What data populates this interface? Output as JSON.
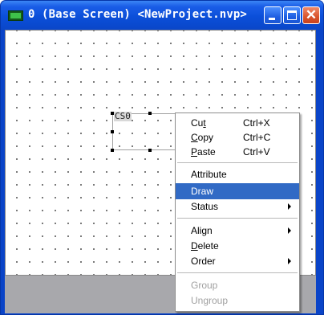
{
  "window": {
    "title": "0 (Base Screen) <NewProject.nvp>",
    "icons": {
      "app": "screen-icon",
      "minimize": "minimize-icon",
      "maximize": "maximize-icon",
      "close": "close-icon"
    },
    "close_glyph": "✕"
  },
  "object": {
    "label": "CS0"
  },
  "menu": {
    "items": [
      {
        "label_pre": "Cu",
        "label_acc": "t",
        "label_post": "",
        "shortcut": "Ctrl+X"
      },
      {
        "label_pre": "",
        "label_acc": "C",
        "label_post": "opy",
        "shortcut": "Ctrl+C"
      },
      {
        "label_pre": "",
        "label_acc": "P",
        "label_post": "aste",
        "shortcut": "Ctrl+V"
      },
      {
        "label": "Attribute"
      },
      {
        "label": "Draw",
        "state": "highlighted"
      },
      {
        "label": "Status",
        "submenu": true
      },
      {
        "label": "Align",
        "submenu": true
      },
      {
        "label_pre": "",
        "label_acc": "D",
        "label_post": "elete"
      },
      {
        "label": "Order",
        "submenu": true
      },
      {
        "label": "Group",
        "state": "disabled"
      },
      {
        "label": "Ungroup",
        "state": "disabled"
      }
    ]
  },
  "colors": {
    "titlebar": "#0a46c8",
    "highlight": "#316ac5",
    "close_button": "#d9542c",
    "disabled_text": "#a0a0a0"
  }
}
